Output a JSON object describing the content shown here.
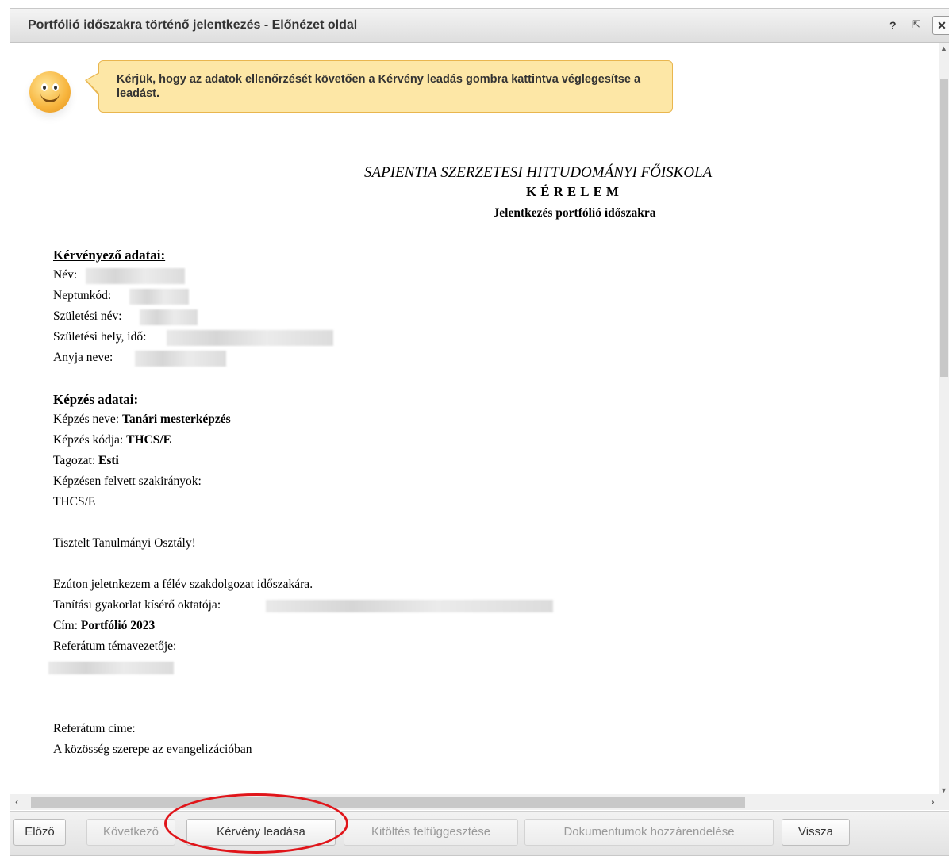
{
  "window": {
    "title": "Portfólió időszakra történő jelentkezés - Előnézet oldal",
    "help_label": "?",
    "popout_label": "⇱",
    "close_label": "✕"
  },
  "notice": {
    "text": "Kérjük, hogy az adatok ellenőrzését követően a Kérvény leadás gombra kattintva véglegesítse a leadást."
  },
  "document": {
    "institution": "SAPIENTIA SZERZETESI HITTUDOMÁNYI FŐISKOLA",
    "heading": "KÉRELEM",
    "subheading": "Jelentkezés portfólió időszakra",
    "applicant": {
      "section_title": "Kérvényező adatai:",
      "name_label": "Név:",
      "neptun_label": "Neptunkód:",
      "birth_name_label": "Születési név:",
      "birth_place_label": "Születési hely, idő:",
      "mother_label": "Anyja neve:"
    },
    "training": {
      "section_title": "Képzés adatai:",
      "name_label": "Képzés neve:",
      "name_value": "Tanári mesterképzés",
      "code_label": "Képzés kódja:",
      "code_value": "THCS/E",
      "mode_label": "Tagozat:",
      "mode_value": "Esti",
      "spec_label": "Képzésen felvett szakirányok:",
      "spec_value": "THCS/E"
    },
    "greeting": "Tisztelt Tanulmányi Osztály!",
    "body_line": "Ezúton jeletnkezem a félév szakdolgozat időszakára.",
    "supervisor_label": "Tanítási gyakorlat kísérő oktatója:",
    "title_label": "Cím:",
    "title_value": "Portfólió 2023",
    "referat_supervisor_label": "Referátum témavezetője:",
    "referat_title_label": "Referátum címe:",
    "referat_title_value": "A közösség szerepe az evangelizációban"
  },
  "toolbar": {
    "prev": "Előző",
    "next": "Következő",
    "submit": "Kérvény leadása",
    "suspend": "Kitöltés felfüggesztése",
    "assign_docs": "Dokumentumok hozzárendelése",
    "back": "Vissza"
  },
  "colors": {
    "notice_bg": "#fde7a6",
    "notice_border": "#e9b64f",
    "highlight": "#e0151a"
  }
}
